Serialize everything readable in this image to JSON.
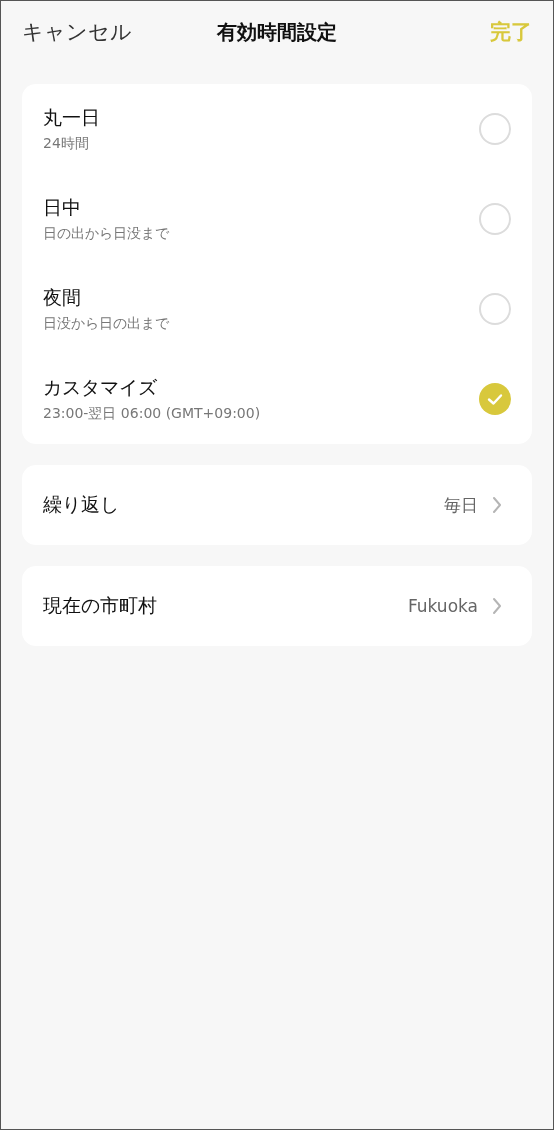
{
  "header": {
    "cancel": "キャンセル",
    "title": "有効時間設定",
    "done": "完了"
  },
  "options": [
    {
      "label": "丸一日",
      "sublabel": "24時間",
      "selected": false
    },
    {
      "label": "日中",
      "sublabel": "日の出から日没まで",
      "selected": false
    },
    {
      "label": "夜間",
      "sublabel": "日没から日の出まで",
      "selected": false
    },
    {
      "label": "カスタマイズ",
      "sublabel": "23:00-翌日 06:00 (GMT+09:00)",
      "selected": true
    }
  ],
  "settings": [
    {
      "label": "繰り返し",
      "value": "毎日"
    },
    {
      "label": "現在の市町村",
      "value": "Fukuoka"
    }
  ]
}
